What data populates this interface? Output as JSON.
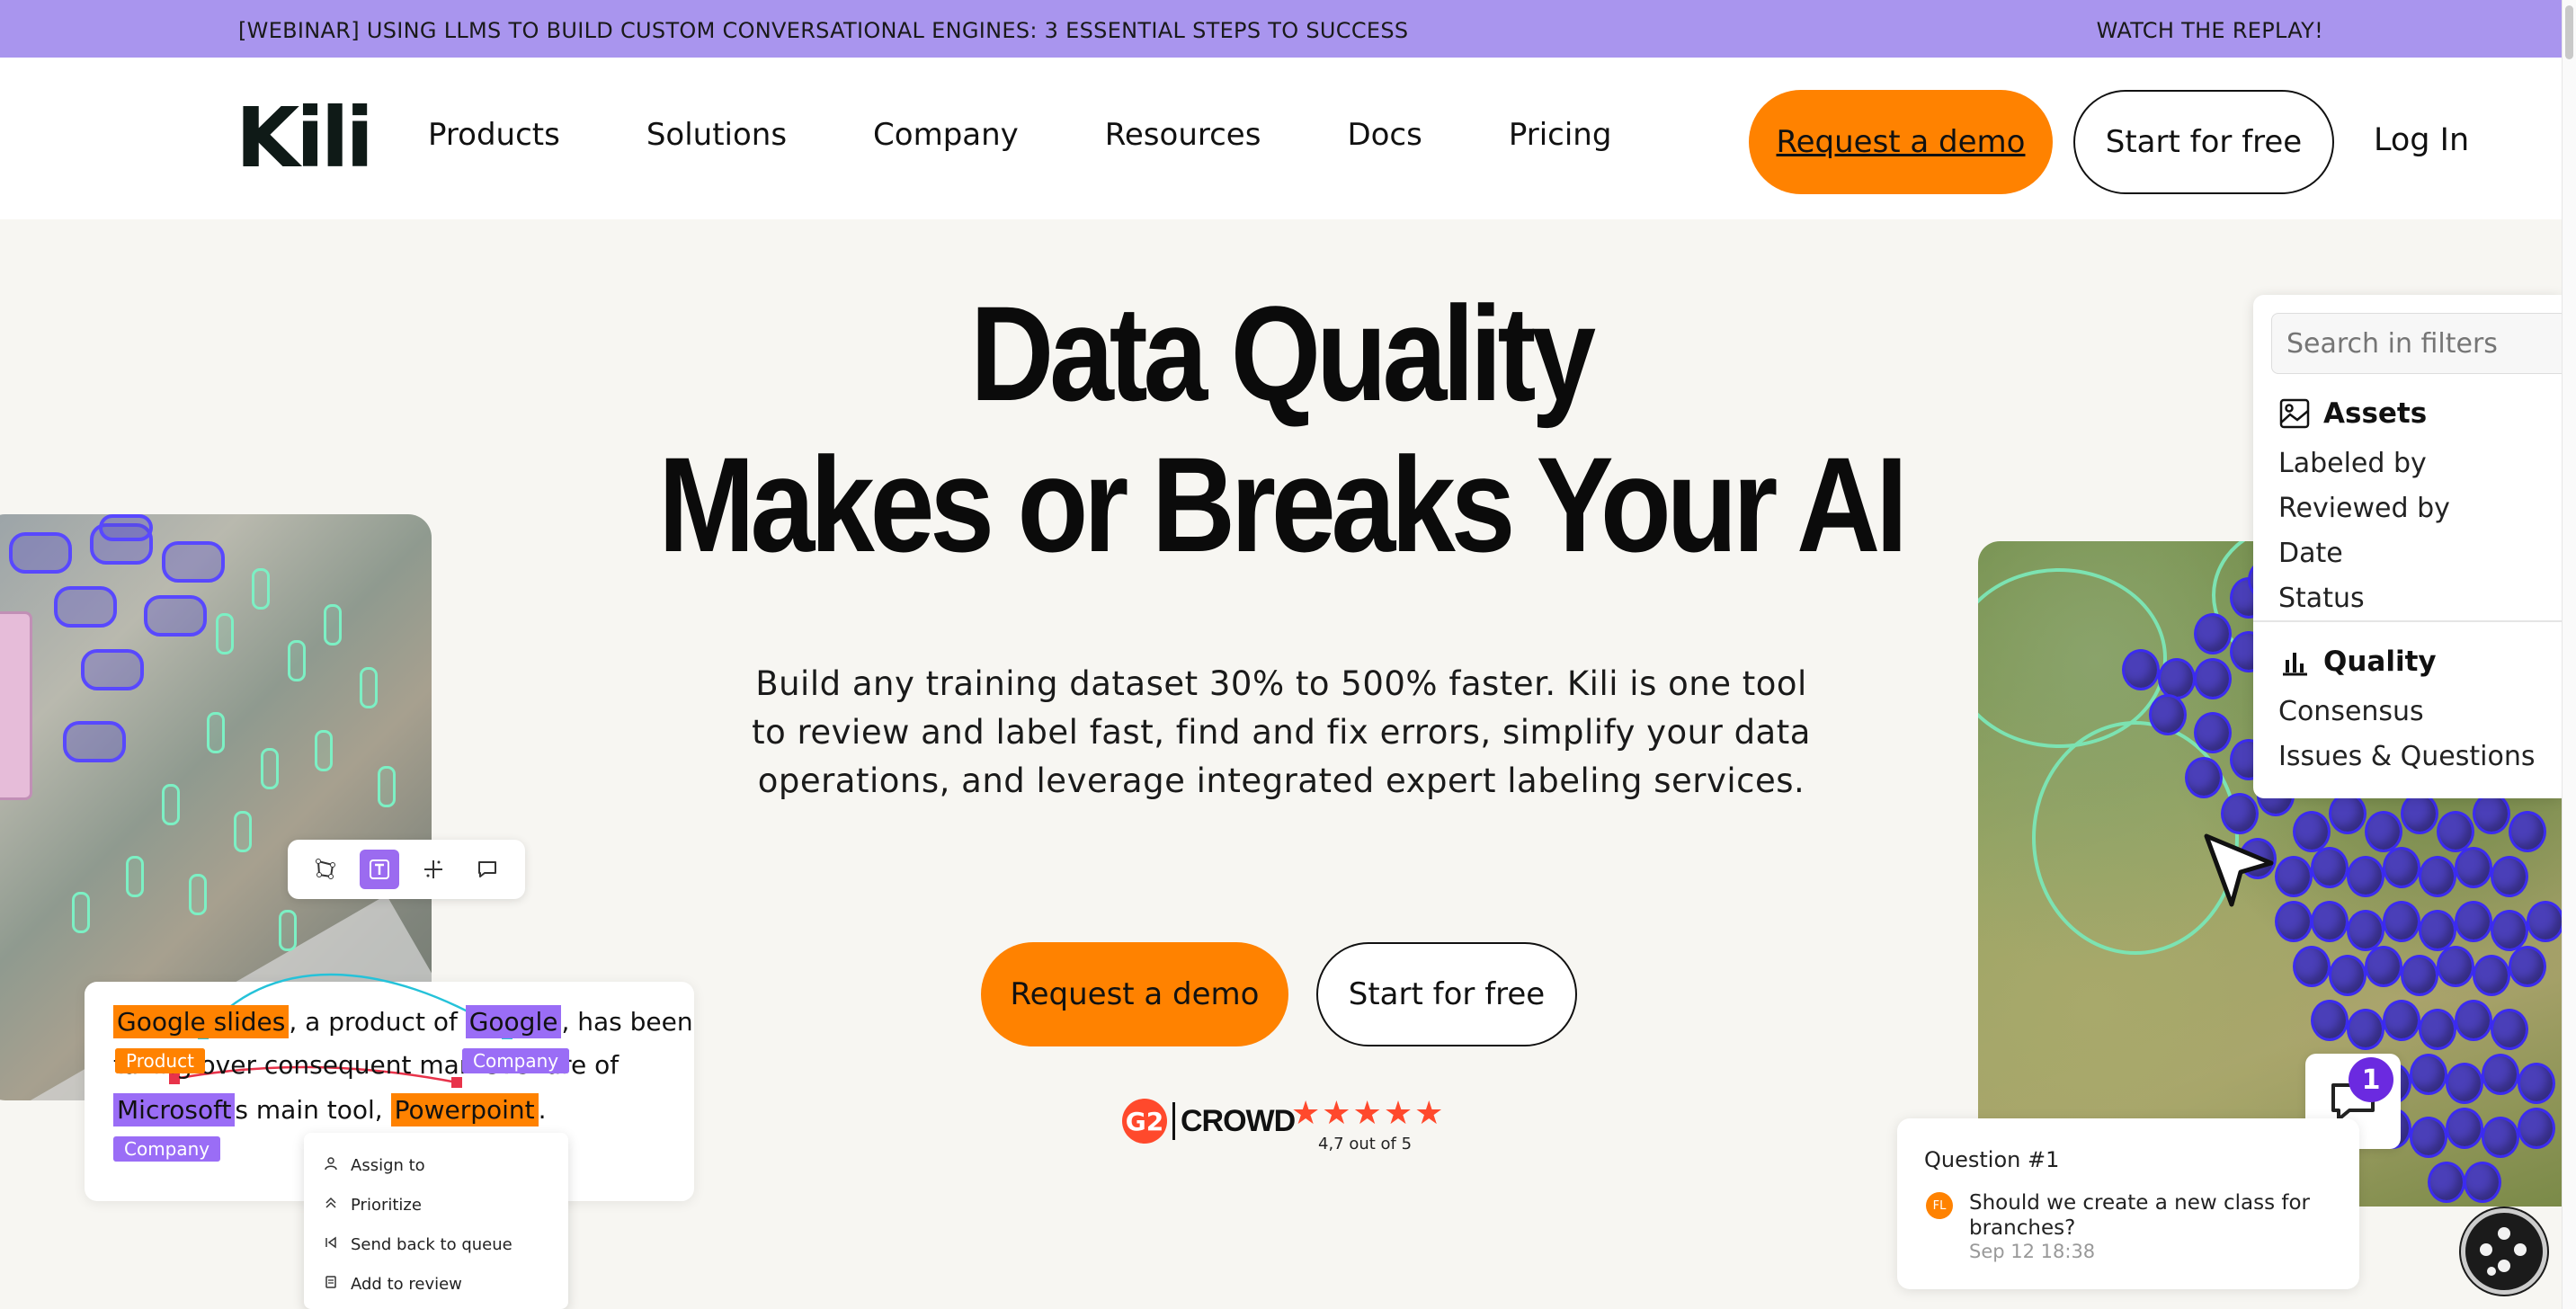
{
  "banner": {
    "text": "[WEBINAR] USING LLMS TO BUILD CUSTOM CONVERSATIONAL ENGINES: 3 ESSENTIAL STEPS TO SUCCESS",
    "cta": "WATCH THE REPLAY!"
  },
  "nav": {
    "logo": "Kili",
    "links": [
      "Products",
      "Solutions",
      "Company",
      "Resources",
      "Docs",
      "Pricing"
    ],
    "request_demo": "Request a demo",
    "start_free": "Start for free",
    "login": "Log In"
  },
  "hero": {
    "title_line1": "Data Quality",
    "title_line2": "Makes or Breaks Your AI",
    "subtitle": "Build any training dataset 30% to 500% faster. Kili is one tool to review and label fast, find and fix errors, simplify your data operations, and leverage integrated expert labeling services.",
    "request_demo": "Request a demo",
    "start_free": "Start for free",
    "rating_brand_mark": "G2",
    "rating_brand": "CROWD",
    "stars": "★★★★★",
    "rating": "4,7 out of 5"
  },
  "ner_card": {
    "entity1": "Google slides",
    "text1": ", a product of ",
    "entity2": "Google",
    "text2": ", has been",
    "line2": "taking over consequent market share of",
    "entity3": "Microsoft",
    "text3": "s main tool, ",
    "entity4": "Powerpoint",
    "text4": ".",
    "tag_product": "Product",
    "tag_company1": "Company",
    "tag_company2": "Company"
  },
  "context_menu": [
    {
      "icon": "user-icon",
      "label": "Assign to"
    },
    {
      "icon": "priority-icon",
      "label": "Prioritize"
    },
    {
      "icon": "send-back-icon",
      "label": "Send back to queue"
    },
    {
      "icon": "review-icon",
      "label": "Add to review"
    }
  ],
  "filter_panel": {
    "search_placeholder": "Search in filters",
    "assets_heading": "Assets",
    "assets_items": [
      "Labeled by",
      "Reviewed by",
      "Date",
      "Status"
    ],
    "quality_heading": "Quality",
    "quality_items": [
      "Consensus",
      "Issues & Questions"
    ]
  },
  "question": {
    "title": "Question #1",
    "avatar": "FL",
    "text": "Should we create a new class for branches?",
    "time": "Sep 12 18:38"
  },
  "comment_badge": "1",
  "colors": {
    "banner": "#A995EE",
    "accent_orange": "#FF8200",
    "entity_purple": "#9A6DF6",
    "background": "#F7F6F2"
  }
}
